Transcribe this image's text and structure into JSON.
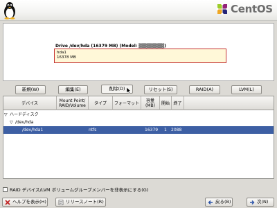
{
  "brand": {
    "name": "CentOS"
  },
  "drive": {
    "label": "Drive /dev/hda (16379 MB) (Model: ▒▒▒▒▒▒▒▒)",
    "partition_name": "hda1",
    "partition_size": "16378 MB"
  },
  "toolbar": {
    "new": "新規(W)",
    "edit": "編集(E)",
    "delete": "削除(D)",
    "reset": "リセット(S)",
    "raid": "RAID(A)",
    "lvm": "LVM(L)"
  },
  "table": {
    "columns": [
      "デバイス",
      "Mount Point/ RAID/Volume",
      "タイプ",
      "フォーマット",
      "容量 (MB)",
      "開始",
      "終了"
    ],
    "rows": [
      {
        "expander": "▽",
        "device": "ハードディスク",
        "mount": "",
        "type": "",
        "format": "",
        "size": "",
        "start": "",
        "end": ""
      },
      {
        "expander": "▽",
        "device": "/dev/hda",
        "mount": "",
        "type": "",
        "format": "",
        "size": "",
        "start": "",
        "end": ""
      },
      {
        "expander": "",
        "device": "/dev/hda1",
        "mount": "",
        "type": "ntfs",
        "format": "",
        "size": "16379",
        "start": "1",
        "end": "2088"
      }
    ]
  },
  "options": {
    "hide_raid_label": "RAID デバイス/LVM ボリュームグループメンバーを非表示にする(G)",
    "hide_raid_checked": false
  },
  "footer": {
    "help": "ヘルプを表示(H)",
    "release_notes": "リリースノート(R)",
    "back": "戻る(B)",
    "next": "次(N)"
  },
  "colors": {
    "selection": "#3d5fa4",
    "drive_box_border": "#c43030",
    "drive_box_fill": "#fff8d8"
  }
}
